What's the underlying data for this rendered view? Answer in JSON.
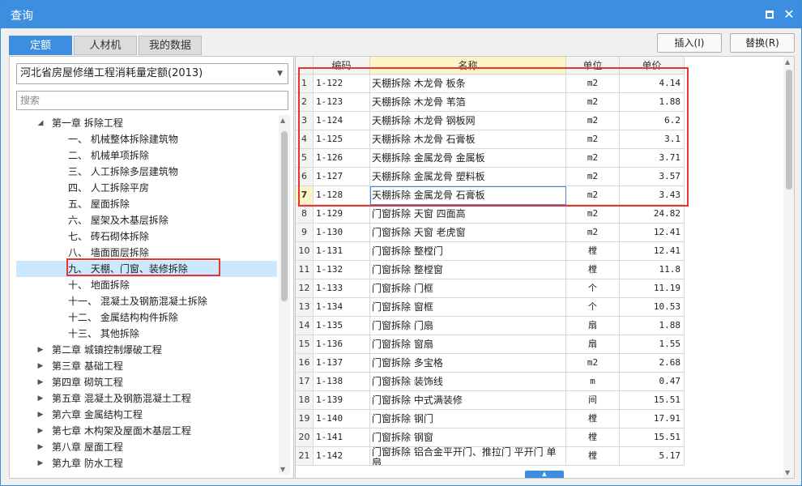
{
  "window": {
    "title": "查询"
  },
  "tabs": [
    {
      "label": "定额",
      "active": true
    },
    {
      "label": "人材机",
      "active": false
    },
    {
      "label": "我的数据",
      "active": false
    }
  ],
  "actions": {
    "insert": "插入(I)",
    "replace": "替换(R)"
  },
  "library": {
    "selected": "河北省房屋修缮工程消耗量定额(2013)"
  },
  "search": {
    "placeholder": "搜索",
    "value": ""
  },
  "tree": [
    {
      "label": "第一章 拆除工程",
      "level": 0,
      "expanded": true
    },
    {
      "label": "一、 机械整体拆除建筑物",
      "level": 1
    },
    {
      "label": "二、 机械单项拆除",
      "level": 1
    },
    {
      "label": "三、 人工拆除多层建筑物",
      "level": 1
    },
    {
      "label": "四、 人工拆除平房",
      "level": 1
    },
    {
      "label": "五、 屋面拆除",
      "level": 1
    },
    {
      "label": "六、 屋架及木基层拆除",
      "level": 1
    },
    {
      "label": "七、 砖石砌体拆除",
      "level": 1
    },
    {
      "label": "八、 墙面面层拆除",
      "level": 1
    },
    {
      "label": "九、 天棚、门窗、装修拆除",
      "level": 1,
      "selected": true
    },
    {
      "label": "十、 地面拆除",
      "level": 1
    },
    {
      "label": "十一、 混凝土及钢筋混凝土拆除",
      "level": 1
    },
    {
      "label": "十二、 金属结构构件拆除",
      "level": 1
    },
    {
      "label": "十三、 其他拆除",
      "level": 1
    },
    {
      "label": "第二章 城镇控制爆破工程",
      "level": 0,
      "expanded": false
    },
    {
      "label": "第三章 基础工程",
      "level": 0,
      "expanded": false
    },
    {
      "label": "第四章 砌筑工程",
      "level": 0,
      "expanded": false
    },
    {
      "label": "第五章 混凝土及钢筋混凝土工程",
      "level": 0,
      "expanded": false
    },
    {
      "label": "第六章 金属结构工程",
      "level": 0,
      "expanded": false
    },
    {
      "label": "第七章 木构架及屋面木基层工程",
      "level": 0,
      "expanded": false
    },
    {
      "label": "第八章 屋面工程",
      "level": 0,
      "expanded": false
    },
    {
      "label": "第九章 防水工程",
      "level": 0,
      "expanded": false
    }
  ],
  "table": {
    "columns": [
      "编码",
      "名称",
      "单位",
      "单价"
    ],
    "active_column": 1,
    "current_row": 7,
    "rows": [
      {
        "num": "1",
        "code": "1-122",
        "name": "天棚拆除 木龙骨 板条",
        "unit": "m2",
        "price": "4.14"
      },
      {
        "num": "2",
        "code": "1-123",
        "name": "天棚拆除 木龙骨 苇箔",
        "unit": "m2",
        "price": "1.88"
      },
      {
        "num": "3",
        "code": "1-124",
        "name": "天棚拆除 木龙骨 钢板网",
        "unit": "m2",
        "price": "6.2"
      },
      {
        "num": "4",
        "code": "1-125",
        "name": "天棚拆除 木龙骨 石膏板",
        "unit": "m2",
        "price": "3.1"
      },
      {
        "num": "5",
        "code": "1-126",
        "name": "天棚拆除 金属龙骨 金属板",
        "unit": "m2",
        "price": "3.71"
      },
      {
        "num": "6",
        "code": "1-127",
        "name": "天棚拆除 金属龙骨 塑料板",
        "unit": "m2",
        "price": "3.57"
      },
      {
        "num": "7",
        "code": "1-128",
        "name": "天棚拆除 金属龙骨 石膏板",
        "unit": "m2",
        "price": "3.43"
      },
      {
        "num": "8",
        "code": "1-129",
        "name": "门窗拆除 天窗 四面高",
        "unit": "m2",
        "price": "24.82"
      },
      {
        "num": "9",
        "code": "1-130",
        "name": "门窗拆除 天窗 老虎窗",
        "unit": "m2",
        "price": "12.41"
      },
      {
        "num": "10",
        "code": "1-131",
        "name": "门窗拆除 整樘门",
        "unit": "樘",
        "price": "12.41"
      },
      {
        "num": "11",
        "code": "1-132",
        "name": "门窗拆除 整樘窗",
        "unit": "樘",
        "price": "11.8"
      },
      {
        "num": "12",
        "code": "1-133",
        "name": "门窗拆除 门框",
        "unit": "个",
        "price": "11.19"
      },
      {
        "num": "13",
        "code": "1-134",
        "name": "门窗拆除 窗框",
        "unit": "个",
        "price": "10.53"
      },
      {
        "num": "14",
        "code": "1-135",
        "name": "门窗拆除 门扇",
        "unit": "扇",
        "price": "1.88"
      },
      {
        "num": "15",
        "code": "1-136",
        "name": "门窗拆除 窗扇",
        "unit": "扇",
        "price": "1.55"
      },
      {
        "num": "16",
        "code": "1-137",
        "name": "门窗拆除 多宝格",
        "unit": "m2",
        "price": "2.68"
      },
      {
        "num": "17",
        "code": "1-138",
        "name": "门窗拆除 装饰线",
        "unit": "m",
        "price": "0.47"
      },
      {
        "num": "18",
        "code": "1-139",
        "name": "门窗拆除 中式满装修",
        "unit": "间",
        "price": "15.51"
      },
      {
        "num": "19",
        "code": "1-140",
        "name": "门窗拆除 钢门",
        "unit": "樘",
        "price": "17.91"
      },
      {
        "num": "20",
        "code": "1-141",
        "name": "门窗拆除 钢窗",
        "unit": "樘",
        "price": "15.51"
      },
      {
        "num": "21",
        "code": "1-142",
        "name": "门窗拆除 铝合金平开门、推拉门 平开门 单扇",
        "unit": "樘",
        "price": "5.17"
      }
    ]
  },
  "colors": {
    "accent": "#3d8ee0",
    "highlight": "#e8352f",
    "selected_bg": "#cce8ff"
  }
}
